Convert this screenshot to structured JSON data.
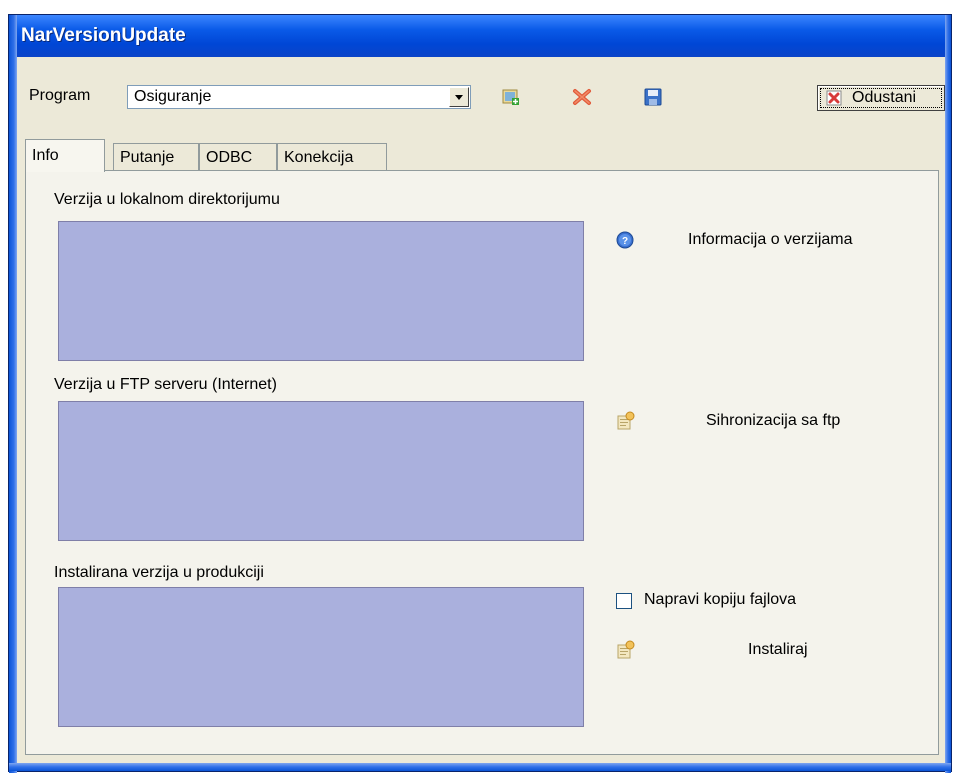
{
  "window": {
    "title": "NarVersionUpdate"
  },
  "toolbar": {
    "program_label": "Program",
    "program_value": "Osiguranje",
    "odustani_label": "Odustani"
  },
  "tabs": [
    {
      "label": "Info",
      "active": true
    },
    {
      "label": "Putanje",
      "active": false
    },
    {
      "label": "ODBC",
      "active": false
    },
    {
      "label": "Konekcija",
      "active": false
    }
  ],
  "info": {
    "local_label": "Verzija u lokalnom direktorijumu",
    "ftp_label": "Verzija u FTP serveru (Internet)",
    "production_label": "Instalirana verzija u produkciji",
    "info_versions_label": "Informacija o verzijama",
    "sync_ftp_label": "Sihronizacija sa ftp",
    "backup_checkbox_label": "Napravi kopiju fajlova",
    "backup_checked": false,
    "install_label": "Instaliraj"
  },
  "colors": {
    "titlebar": "#0a5ae8",
    "window_bg": "#ece9d8",
    "version_box": "#aab0dd"
  }
}
